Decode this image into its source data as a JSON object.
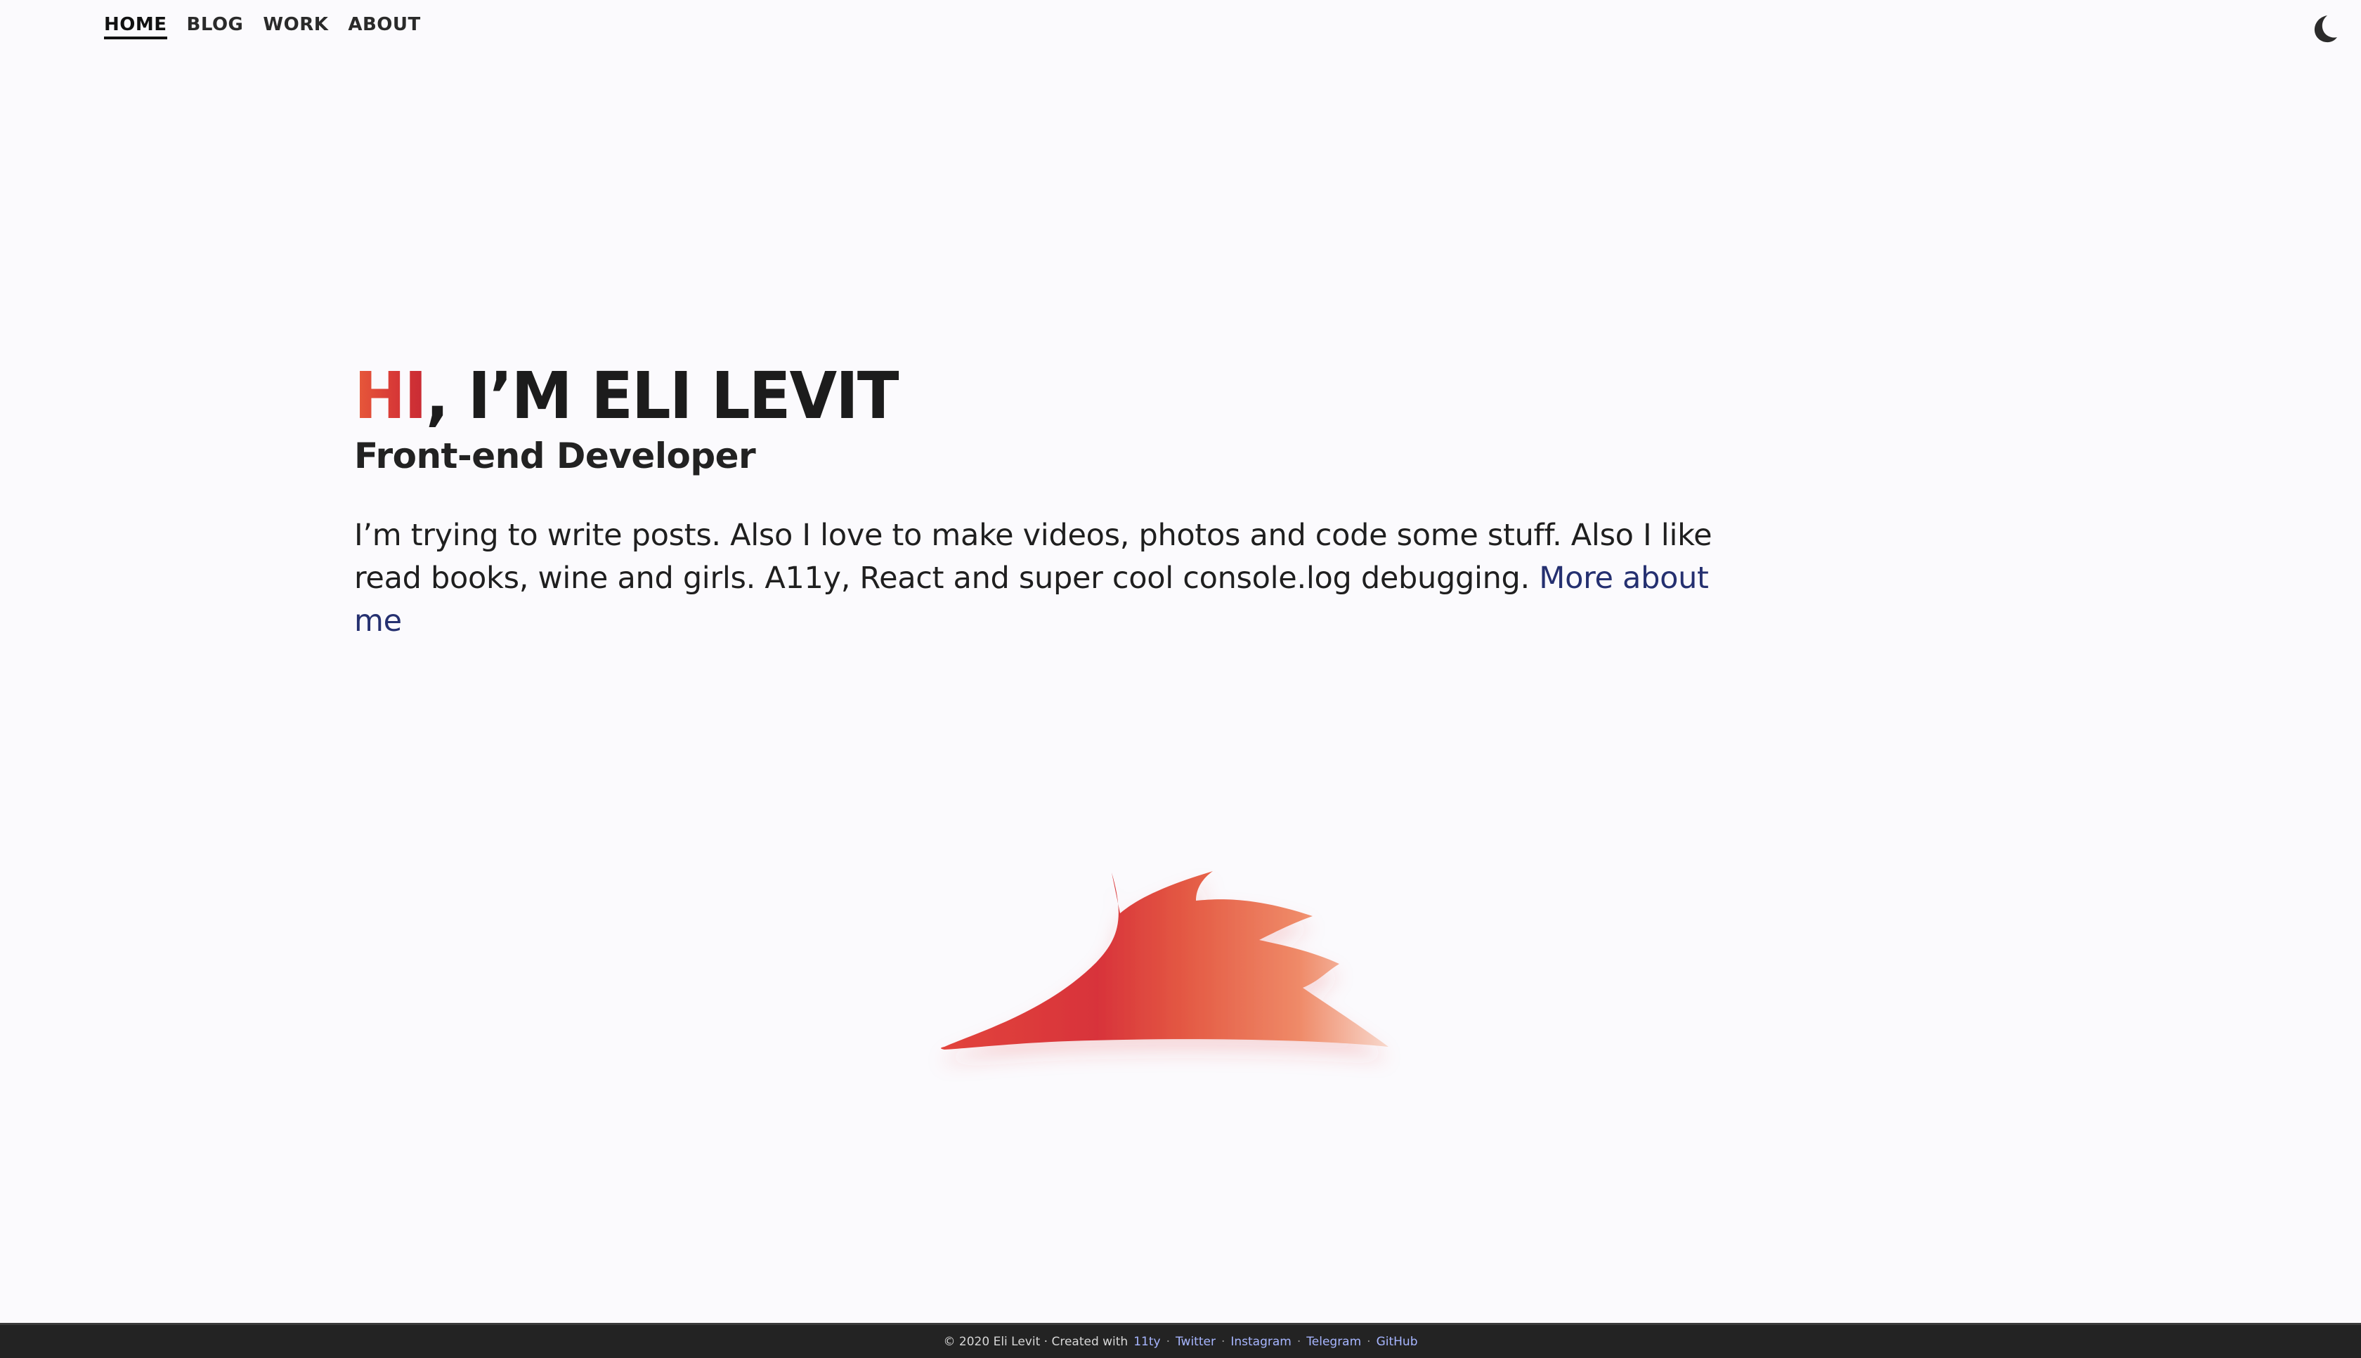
{
  "nav": {
    "items": [
      {
        "label": "HOME",
        "active": true
      },
      {
        "label": "BLOG",
        "active": false
      },
      {
        "label": "WORK",
        "active": false
      },
      {
        "label": "ABOUT",
        "active": false
      }
    ],
    "theme_toggle_icon": "moon-icon"
  },
  "hero": {
    "title_highlight": "HI",
    "title_rest": ", I’M ELI LEVIT",
    "subtitle": "Front-end Developer",
    "intro_text": "I’m trying to write posts. Also I love to make videos, photos and code some stuff. Also I like read books, wine and girls. A11y, React and super cool console.log debugging.",
    "intro_link": "More about me",
    "highlight_gradient": [
      "#e85b3a",
      "#d83a37",
      "#c82a34"
    ],
    "link_color": "#253070"
  },
  "illustration": {
    "icon": "red-hair-flame-icon",
    "colors": [
      "#d8333a",
      "#e04a3a",
      "#ef8a68",
      "#f6d0c4"
    ]
  },
  "footer": {
    "copyright": "© 2020 Eli Levit · Created with",
    "links": [
      "11ty",
      "Twitter",
      "Instagram",
      "Telegram",
      "GitHub"
    ],
    "separator": "·",
    "background": "#232323",
    "link_color": "#a7b6ff"
  }
}
